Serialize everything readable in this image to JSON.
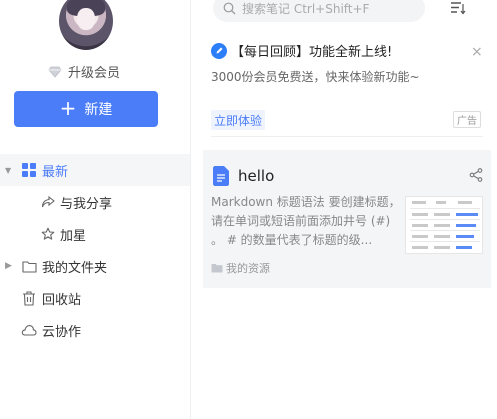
{
  "sidebar": {
    "upgrade_label": "升级会员",
    "new_button_label": "新建",
    "nav": [
      {
        "label": "最新",
        "icon": "grid-icon",
        "active": true
      },
      {
        "label": "与我分享",
        "icon": "share-arrow-icon"
      },
      {
        "label": "加星",
        "icon": "star-icon"
      },
      {
        "label": "我的文件夹",
        "icon": "folder-icon"
      },
      {
        "label": "回收站",
        "icon": "trash-icon"
      },
      {
        "label": "云协作",
        "icon": "cloud-icon"
      }
    ]
  },
  "search": {
    "placeholder": "搜索笔记 Ctrl+Shift+F"
  },
  "banner": {
    "title": "【每日回顾】功能全新上线!",
    "close": "×",
    "subtitle": "3000份会员免费送，快来体验新功能~",
    "cta": "立即体验",
    "ad_tag": "广告"
  },
  "note": {
    "title": "hello",
    "excerpt": "Markdown 标题语法 要创建标题，请在单词或短语前面添加井号 (#) 。 # 的数量代表了标题的级...",
    "folder": "我的资源"
  },
  "colors": {
    "accent": "#4b7df8",
    "card_bg": "#f4f5f7"
  }
}
